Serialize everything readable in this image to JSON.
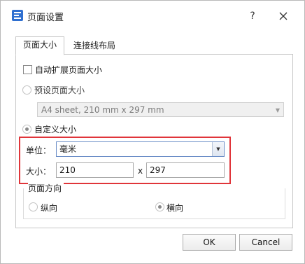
{
  "dialog": {
    "title": "页面设置",
    "help_label": "?",
    "icon": "app-logo-icon",
    "close_icon": "close-icon"
  },
  "tabs": [
    {
      "label": "页面大小",
      "active": true
    },
    {
      "label": "连接线布局",
      "active": false
    }
  ],
  "page_size": {
    "auto_expand_label": "自动扩展页面大小",
    "auto_expand_checked": false,
    "preset_label": "预设页面大小",
    "preset_value": "A4 sheet, 210 mm x 297 mm",
    "custom_label": "自定义大小",
    "unit_label": "单位：",
    "unit_value": "毫米",
    "size_label": "大小：",
    "width_value": "210",
    "times_label": "x",
    "height_value": "297"
  },
  "orientation": {
    "group_title": "页面方向",
    "portrait_label": "纵向",
    "landscape_label": "横向",
    "selected": "landscape"
  },
  "buttons": {
    "ok_label": "OK",
    "cancel_label": "Cancel"
  },
  "colors": {
    "highlight": "#e0353a",
    "accent_blue": "#3a6fc9"
  }
}
